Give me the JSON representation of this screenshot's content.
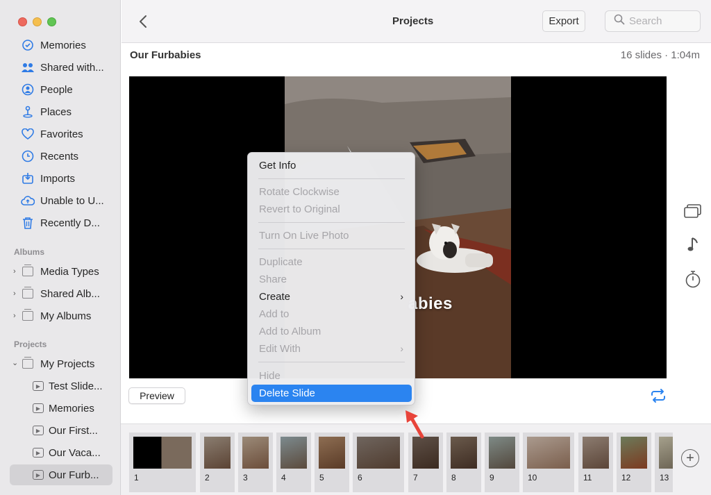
{
  "sidebar": {
    "library_items": [
      {
        "label": "Memories",
        "icon": "memories-icon"
      },
      {
        "label": "Shared with...",
        "icon": "shared-with-you-icon"
      },
      {
        "label": "People",
        "icon": "people-icon"
      },
      {
        "label": "Places",
        "icon": "places-icon"
      },
      {
        "label": "Favorites",
        "icon": "heart-icon"
      },
      {
        "label": "Recents",
        "icon": "clock-icon"
      },
      {
        "label": "Imports",
        "icon": "import-icon"
      },
      {
        "label": "Unable to U...",
        "icon": "cloud-icon"
      },
      {
        "label": "Recently D...",
        "icon": "trash-icon"
      }
    ],
    "albums_header": "Albums",
    "albums": [
      {
        "label": "Media Types"
      },
      {
        "label": "Shared Alb..."
      },
      {
        "label": "My Albums"
      }
    ],
    "projects_header": "Projects",
    "my_projects": "My Projects",
    "projects": [
      {
        "label": "Test Slide..."
      },
      {
        "label": "Memories"
      },
      {
        "label": "Our First..."
      },
      {
        "label": "Our Vaca..."
      },
      {
        "label": "Our Furb..."
      }
    ]
  },
  "toolbar": {
    "title": "Projects",
    "export_label": "Export",
    "search_placeholder": "Search"
  },
  "project": {
    "name": "Our Furbabies",
    "info": "16 slides · 1:04m",
    "title_overlay": "abies"
  },
  "preview_label": "Preview",
  "context_menu": {
    "items": [
      {
        "label": "Get Info"
      },
      {
        "label": "Rotate Clockwise"
      },
      {
        "label": "Revert to Original"
      },
      {
        "label": "Turn On Live Photo"
      },
      {
        "label": "Duplicate"
      },
      {
        "label": "Share"
      },
      {
        "label": "Create"
      },
      {
        "label": "Add to"
      },
      {
        "label": "Add to Album"
      },
      {
        "label": "Edit With"
      },
      {
        "label": "Hide"
      },
      {
        "label": "Delete Slide"
      }
    ]
  },
  "filmstrip": {
    "slides": [
      "1",
      "2",
      "3",
      "4",
      "5",
      "6",
      "7",
      "8",
      "9",
      "10",
      "11",
      "12",
      "13"
    ]
  },
  "colors": {
    "accent": "#2b84f0",
    "sidebar_icon": "#2f7be5",
    "annotation_arrow": "#e8443a"
  }
}
